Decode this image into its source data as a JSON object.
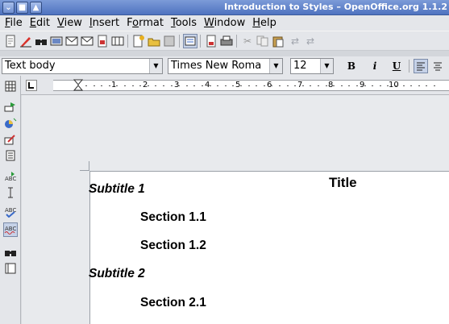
{
  "window": {
    "title": "Introduction to Styles – OpenOffice.org 1.1.2",
    "buttons": [
      "⌄",
      "■",
      "▲"
    ]
  },
  "menu": {
    "items": [
      "File",
      "Edit",
      "View",
      "Insert",
      "Format",
      "Tools",
      "Window",
      "Help"
    ],
    "mnemonics": [
      "F",
      "E",
      "V",
      "I",
      "o",
      "T",
      "W",
      "H"
    ]
  },
  "formatting": {
    "paragraph_style": "Text body",
    "font_name": "Times New Roma",
    "font_size": "12",
    "bold_label": "B",
    "italic_label": "i",
    "underline_label": "U"
  },
  "ruler": {
    "numbers": [
      "1",
      "2",
      "3",
      "4",
      "5",
      "6",
      "7",
      "8",
      "9",
      "10"
    ]
  },
  "document": {
    "title": "Title",
    "subtitle1": "Subtitle 1",
    "section11": "Section 1.1",
    "section12": "Section 1.2",
    "subtitle2": "Subtitle 2",
    "section21": "Section 2.1"
  },
  "icons": {
    "toolbar": [
      "new-document-icon",
      "edit-file-icon",
      "find-icon",
      "hyperlink-icon",
      "email-icon",
      "email-icon",
      "pdf-icon",
      "gallery-icon",
      "navigator-icon",
      "open-icon",
      "save-icon",
      "datasource-icon",
      "print-icon",
      "print-preview-icon",
      "cut-icon",
      "copy-icon",
      "paste-icon",
      "undo-icon",
      "redo-icon"
    ],
    "left": [
      "table-icon",
      "insert-field-icon",
      "insert-object-icon",
      "draw-icon",
      "edit-icon",
      "spellcheck-auto-icon",
      "text-cursor-icon",
      "spellcheck-icon",
      "autospell-icon",
      "find-replace-icon",
      "datasource-view-icon"
    ]
  }
}
